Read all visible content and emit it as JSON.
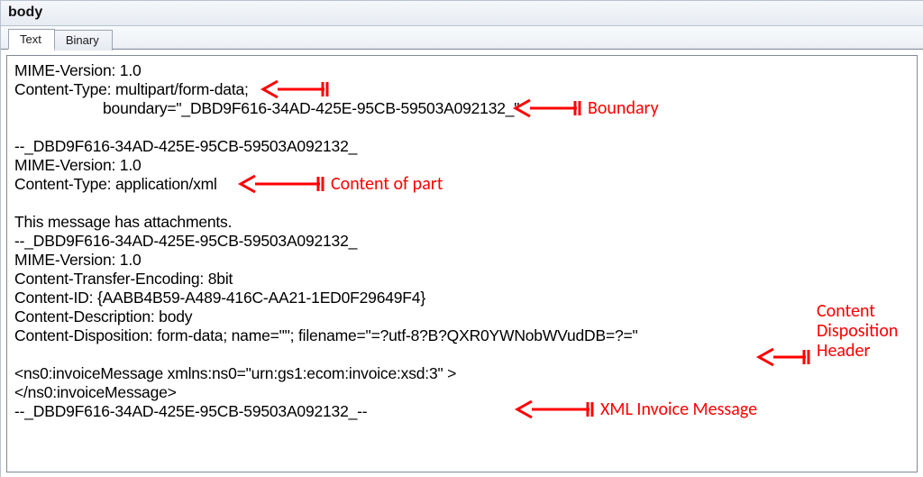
{
  "window": {
    "title": "body"
  },
  "tabs": {
    "text": "Text",
    "binary": "Binary"
  },
  "body_text": {
    "l1": "MIME-Version: 1.0",
    "l2": "Content-Type: multipart/form-data;",
    "l3": "boundary=\"_DBD9F616-34AD-425E-95CB-59503A092132_\"",
    "l4": "",
    "l5": "--_DBD9F616-34AD-425E-95CB-59503A092132_",
    "l6": "MIME-Version: 1.0",
    "l7": "Content-Type: application/xml",
    "l8": "",
    "l9": "This message has attachments.",
    "l10": "--_DBD9F616-34AD-425E-95CB-59503A092132_",
    "l11": "MIME-Version: 1.0",
    "l12": "Content-Transfer-Encoding: 8bit",
    "l13": "Content-ID: {AABB4B59-A489-416C-AA21-1ED0F29649F4}",
    "l14": "Content-Description: body",
    "l15": "Content-Disposition: form-data; name=\"\"; filename=\"=?utf-8?B?QXR0YWNobWVudDB=?=\"",
    "l16": "",
    "l17": "<ns0:invoiceMessage xmlns:ns0=\"urn:gs1:ecom:invoice:xsd:3\" >",
    "l18": "</ns0:invoiceMessage>",
    "l19": "--_DBD9F616-34AD-425E-95CB-59503A092132_--"
  },
  "annotations": {
    "boundary": "Boundary",
    "content_of_part": "Content of part",
    "cdh_l1": "Content",
    "cdh_l2": "Disposition",
    "cdh_l3": "Header",
    "xml_msg": "XML Invoice Message"
  }
}
